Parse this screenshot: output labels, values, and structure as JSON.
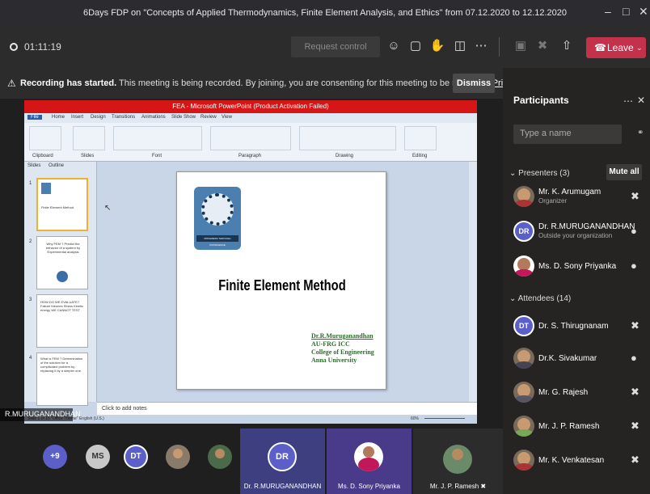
{
  "window": {
    "title": "6Days FDP on \"Concepts of Applied Thermodynamics, Finite Element Analysis, and Ethics\" from 07.12.2020 to 12.12.2020"
  },
  "toolbar": {
    "timer": "01:11:19",
    "request_control": "Request control",
    "leave": "Leave"
  },
  "banner": {
    "bold": "Recording has started.",
    "message": " This meeting is being recorded. By joining, you are consenting for this meeting to be recorded. ",
    "privacy": "Privacy policy",
    "dismiss": "Dismiss"
  },
  "ppt": {
    "title": "FEA - Microsoft PowerPoint (Product Activation Failed)",
    "tabs": [
      "File",
      "Home",
      "Insert",
      "Design",
      "Transitions",
      "Animations",
      "Slide Show",
      "Review",
      "View"
    ],
    "groups": [
      "Clipboard",
      "Slides",
      "Font",
      "Paragraph",
      "Drawing",
      "Editing"
    ],
    "pane_tabs": [
      "Slides",
      "Outline"
    ],
    "thumbs": [
      {
        "num": "1",
        "text": "Finite Element Method"
      },
      {
        "num": "2",
        "text": "Why FEM ? Predict the behavior of a system by Experimental analysis"
      },
      {
        "num": "3",
        "text": "HOW DO WE EVALUATE? Failure theories Stress Kinetic energy WE CANNOT TEST"
      },
      {
        "num": "4",
        "text": "What is FEM ? Determination of the solution for a complicated problem by replacing it by a simpler one."
      }
    ],
    "notes": "Click to add notes",
    "status": "Slide 1 of 15   \"Office Theme\"   English (U.S.)",
    "zoom": "60%"
  },
  "slide": {
    "logo_band": "PROGRESS THROUGH KNOWLEDGE",
    "title": "Finite Element Method",
    "author_lines": [
      "Dr.R.Muruganandhan",
      "AU-FRG ICC",
      "College of Engineering",
      "Anna University"
    ]
  },
  "presenter_badge": "R.MURUGANANDHAN",
  "sidebar": {
    "title": "Participants",
    "search_placeholder": "Type a name",
    "presenters_label": "Presenters (3)",
    "mute_all": "Mute all",
    "attendees_label": "Attendees (14)",
    "presenters": [
      {
        "name": "Mr. K. Arumugam",
        "sub": "Organizer",
        "initials": ""
      },
      {
        "name": "Dr. R.MURUGANANDHAN",
        "sub": "Outside your organization",
        "initials": "DR"
      },
      {
        "name": "Ms. D. Sony Priyanka",
        "sub": "",
        "initials": ""
      }
    ],
    "attendees": [
      {
        "name": "Dr. S. Thirugnanam",
        "initials": "DT"
      },
      {
        "name": "Dr.K. Sivakumar",
        "initials": ""
      },
      {
        "name": "Mr. G. Rajesh",
        "initials": ""
      },
      {
        "name": "Mr. J. P. Ramesh",
        "initials": ""
      },
      {
        "name": "Mr. K. Venkatesan",
        "initials": ""
      }
    ]
  },
  "gallery": {
    "overflow": "+9",
    "circles": [
      "MS",
      "DT"
    ],
    "tiles": [
      {
        "name": "Dr. R.MURUGANANDHAN",
        "initials": "DR"
      },
      {
        "name": "Ms. D. Sony Priyanka",
        "initials": ""
      },
      {
        "name": "Mr. J. P. Ramesh",
        "initials": ""
      }
    ]
  },
  "colors": {
    "leave": "#c4314b",
    "teams_purple": "#5b5fc7",
    "ppt_title_bar": "#d61616"
  }
}
